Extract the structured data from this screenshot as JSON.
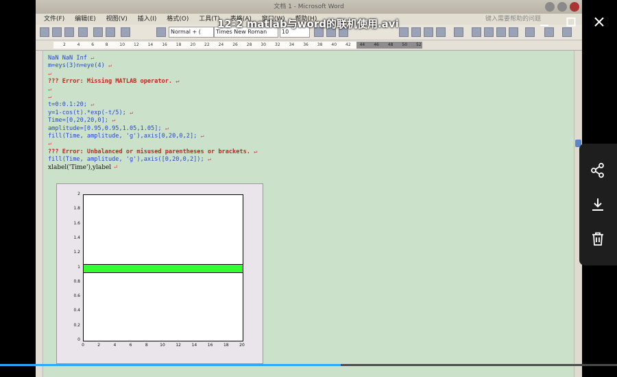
{
  "video": {
    "title": "12-2 matlab与word的联机使用.avi",
    "progress": 0.552
  },
  "word": {
    "window_title": "文档 1 - Microsoft Word",
    "menu": [
      "文件(F)",
      "编辑(E)",
      "视图(V)",
      "插入(I)",
      "格式(O)",
      "工具(T)",
      "表格(A)",
      "窗口(W)",
      "帮助(H)"
    ],
    "help_placeholder": "键入需要帮助的问题",
    "style_dropdown": "Normal + (",
    "font_dropdown": "Times New Roman",
    "size_dropdown": "10",
    "ruler_ticks": [
      "2",
      "4",
      "6",
      "8",
      "10",
      "12",
      "14",
      "16",
      "18",
      "20",
      "22",
      "24",
      "26",
      "28",
      "30",
      "32",
      "34",
      "36",
      "38",
      "40",
      "42",
      "44",
      "46",
      "48",
      "50",
      "52"
    ]
  },
  "document": {
    "lines": [
      {
        "text": "    NaN    NaN    Inf",
        "style": "blue"
      },
      {
        "text": "m=eys(3)n=eye(4)",
        "style": "blue"
      },
      {
        "text": "",
        "style": "blue"
      },
      {
        "text": "??? Error: Missing MATLAB operator.",
        "style": "red"
      },
      {
        "text": "",
        "style": "blue"
      },
      {
        "text": "",
        "style": "blue"
      },
      {
        "text": "t=0:0.1:20;",
        "style": "blue"
      },
      {
        "text": "y=1-cos(t).*exp(-t/5);",
        "style": "blue"
      },
      {
        "text": "Time=[0,20,20,0];",
        "style": "blue"
      },
      {
        "text": "amplitude=[0.95,0.95,1.05,1.05];",
        "style": "blue"
      },
      {
        "text": "fill(Time, amplitude, 'g'),axis[0,20,0,2];",
        "style": "blue"
      },
      {
        "text": "",
        "style": "blue"
      },
      {
        "text": "??? Error: Unbalanced or misused parentheses or brackets.",
        "style": "red"
      },
      {
        "text": "fill(Time, amplitude, 'g'),axis([0,20,0,2]);",
        "style": "blue"
      },
      {
        "text": "xlabel('Time'),ylabel",
        "style": "black"
      }
    ]
  },
  "chart_data": {
    "type": "area",
    "x": [
      0,
      20,
      20,
      0
    ],
    "y": [
      0.95,
      0.95,
      1.05,
      1.05
    ],
    "xlim": [
      0,
      20
    ],
    "ylim": [
      0,
      2
    ],
    "xticks": [
      "0",
      "2",
      "4",
      "6",
      "8",
      "10",
      "12",
      "14",
      "16",
      "18",
      "20"
    ],
    "yticks": [
      "0",
      "0.2",
      "0.4",
      "0.6",
      "0.8",
      "1",
      "1.2",
      "1.4",
      "1.6",
      "1.8",
      "2"
    ],
    "fill_color": "#33ff33",
    "title": "",
    "xlabel": "",
    "ylabel": ""
  },
  "actions": {
    "minimize_icon": "minimize-icon",
    "maximize_icon": "maximize-icon",
    "close_icon": "close-icon",
    "share_icon": "share-icon",
    "download_icon": "download-icon",
    "delete_icon": "trash-icon"
  }
}
